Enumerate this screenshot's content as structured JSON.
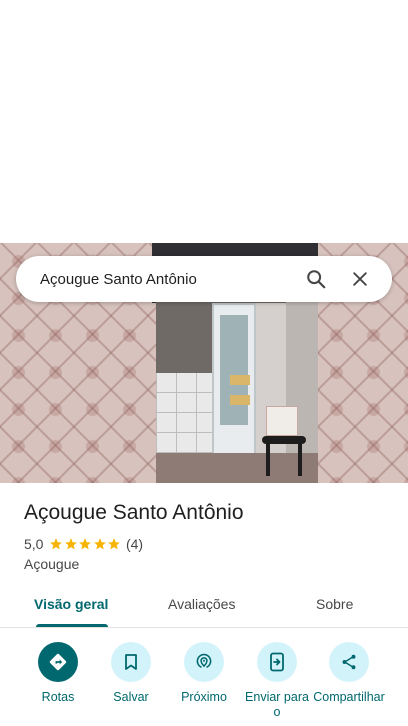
{
  "search": {
    "query": "Açougue Santo Antônio",
    "search_icon": "search-icon",
    "close_icon": "close-icon"
  },
  "place": {
    "name": "Açougue Santo Antônio",
    "rating": "5,0",
    "stars": 5,
    "review_count": "(4)",
    "category": "Açougue"
  },
  "tabs": [
    {
      "label": "Visão geral",
      "active": true
    },
    {
      "label": "Avaliações",
      "active": false
    },
    {
      "label": "Sobre",
      "active": false
    }
  ],
  "actions": [
    {
      "label": "Rotas",
      "icon": "directions-icon"
    },
    {
      "label": "Salvar",
      "icon": "bookmark-icon"
    },
    {
      "label": "Próximo",
      "icon": "nearby-icon"
    },
    {
      "label": "Enviar para o",
      "icon": "send-to-phone-icon"
    },
    {
      "label": "Compartilhar",
      "icon": "share-icon"
    }
  ],
  "colors": {
    "accent": "#00686e",
    "accent_light": "#d3f3fb",
    "star": "#f6b400"
  }
}
